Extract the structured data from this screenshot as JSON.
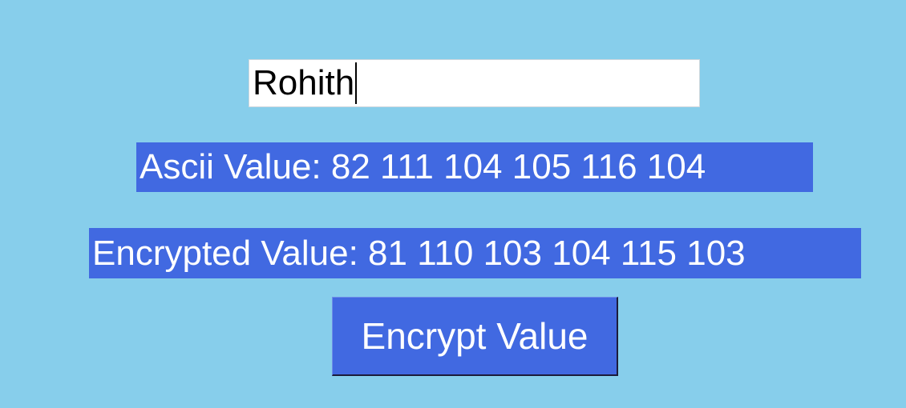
{
  "window": {
    "background_color": "#87CEEB",
    "accent_color": "#4169E1"
  },
  "input": {
    "value": "Rohith"
  },
  "ascii": {
    "label": "Ascii Value: 82 111 104 105 116 104"
  },
  "encrypted": {
    "label": "Encrypted Value: 81 110 103 104 115 103"
  },
  "button": {
    "label": "Encrypt Value"
  }
}
